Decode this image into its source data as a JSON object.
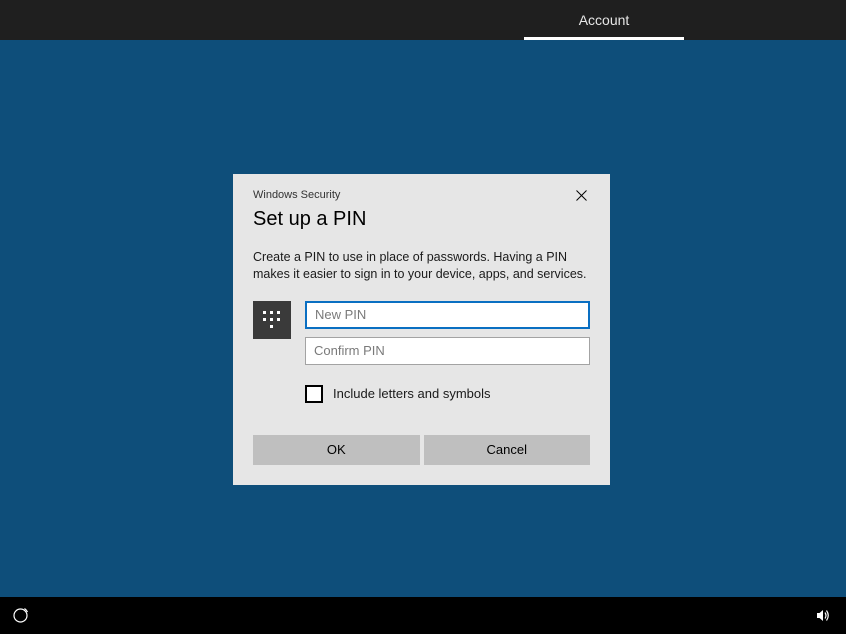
{
  "topbar": {
    "tab_label": "Account"
  },
  "dialog": {
    "window_title": "Windows Security",
    "title": "Set up a PIN",
    "description": "Create a PIN to use in place of passwords. Having a PIN makes it easier to sign in to your device, apps, and services.",
    "new_pin_placeholder": "New PIN",
    "new_pin_value": "",
    "confirm_pin_placeholder": "Confirm PIN",
    "confirm_pin_value": "",
    "include_symbols_checked": false,
    "include_symbols_label": "Include letters and symbols",
    "ok_label": "OK",
    "cancel_label": "Cancel"
  },
  "icons": {
    "keypad": "keypad-icon",
    "close": "close-icon",
    "ease_of_access": "ease-of-access-icon",
    "volume": "volume-icon"
  }
}
